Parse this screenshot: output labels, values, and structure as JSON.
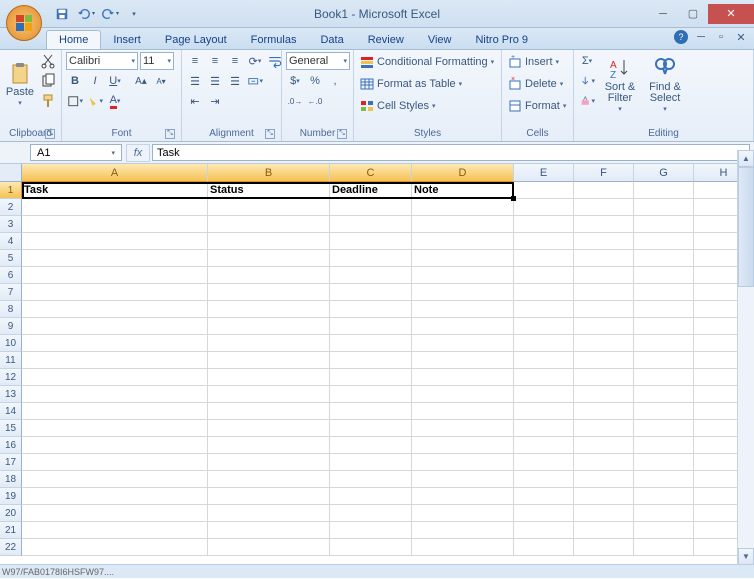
{
  "title": "Book1 - Microsoft Excel",
  "tabs": {
    "home": "Home",
    "insert": "Insert",
    "pagelayout": "Page Layout",
    "formulas": "Formulas",
    "data": "Data",
    "review": "Review",
    "view": "View",
    "nitro": "Nitro Pro 9"
  },
  "ribbon": {
    "clipboard": {
      "label": "Clipboard",
      "paste": "Paste"
    },
    "font": {
      "label": "Font",
      "name": "Calibri",
      "size": "11"
    },
    "alignment": {
      "label": "Alignment"
    },
    "number": {
      "label": "Number",
      "format": "General"
    },
    "styles": {
      "label": "Styles",
      "cond": "Conditional Formatting",
      "table": "Format as Table",
      "cell": "Cell Styles"
    },
    "cells": {
      "label": "Cells",
      "insert": "Insert",
      "delete": "Delete",
      "format": "Format"
    },
    "editing": {
      "label": "Editing",
      "sort": "Sort & Filter",
      "find": "Find & Select"
    }
  },
  "namebox": "A1",
  "formula": "Task",
  "columns": [
    "A",
    "B",
    "C",
    "D",
    "E",
    "F",
    "G",
    "H"
  ],
  "rows": [
    "1",
    "2",
    "3",
    "4",
    "5",
    "6",
    "7",
    "8",
    "9",
    "10",
    "11",
    "12",
    "13",
    "14",
    "15",
    "16",
    "17",
    "18",
    "19",
    "20",
    "21",
    "22"
  ],
  "data": {
    "r1": {
      "A": "Task",
      "B": "Status",
      "C": "Deadline",
      "D": "Note"
    }
  },
  "statusbar": "W97/FAB0178I6HSFW97...."
}
